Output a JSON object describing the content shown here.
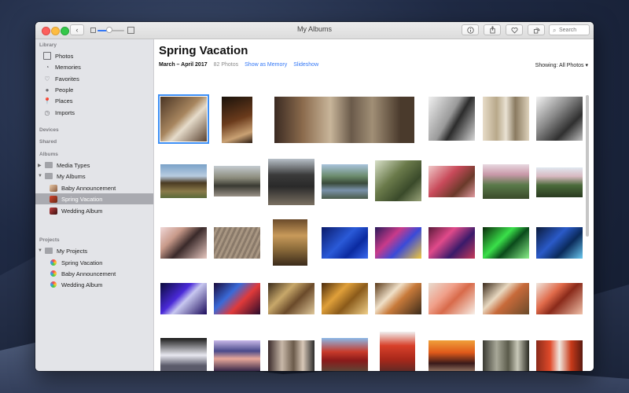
{
  "window": {
    "title": "My Albums",
    "search_placeholder": "Search"
  },
  "sidebar": {
    "library_header": "Library",
    "library_items": [
      "Photos",
      "Memories",
      "Favorites",
      "People",
      "Places",
      "Imports"
    ],
    "devices_header": "Devices",
    "shared_header": "Shared",
    "albums_header": "Albums",
    "media_types": "Media Types",
    "my_albums": "My Albums",
    "albums": [
      "Baby Announcement",
      "Spring Vacation",
      "Wedding Album"
    ],
    "projects_header": "Projects",
    "my_projects": "My Projects",
    "projects": [
      "Spring Vacation",
      "Baby Announcement",
      "Wedding Album"
    ]
  },
  "content": {
    "title": "Spring Vacation",
    "date_range": "March – April 2017",
    "photo_count": "82 Photos",
    "show_as_memory": "Show as Memory",
    "slideshow": "Slideshow",
    "showing": "Showing: All Photos ▾"
  },
  "icons": {
    "back": "chevron-left-icon",
    "info": "info-icon",
    "share": "share-icon",
    "favorite": "heart-icon",
    "rotate": "rotate-icon",
    "search": "search-icon"
  },
  "colors": {
    "accent": "#3478f6",
    "sidebar_bg": "#e3e4e8",
    "selection": "#a9aab0"
  }
}
